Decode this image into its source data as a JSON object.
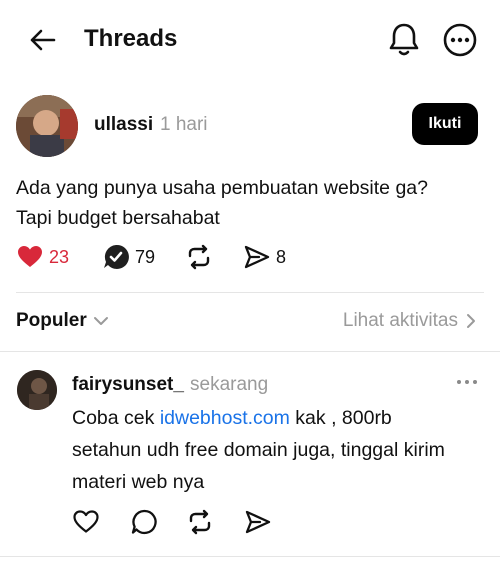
{
  "header": {
    "title": "Threads",
    "back_icon": "arrow-left-icon",
    "notif_icon": "bell-icon",
    "more_icon": "ellipsis-circle-icon"
  },
  "post": {
    "username": "ullassi",
    "time": "1 hari",
    "follow_label": "Ikuti",
    "text_line1": "Ada yang punya usaha pembuatan website ga?",
    "text_line2": "Tapi budget bersahabat",
    "likes": "23",
    "replies": "79",
    "shares": "8",
    "like_color": "#d8283a"
  },
  "sort": {
    "label": "Populer",
    "activity_label": "Lihat aktivitas"
  },
  "reply": {
    "username": "fairysunset_",
    "time": "sekarang",
    "text_before": "Coba cek ",
    "link_text": "idwebhost.com",
    "text_after_link": " kak , 800rb",
    "text_line2": "setahun udh free domain juga, tinggal kirim",
    "text_line3": "materi web nya",
    "link_color": "#1a73e8"
  }
}
